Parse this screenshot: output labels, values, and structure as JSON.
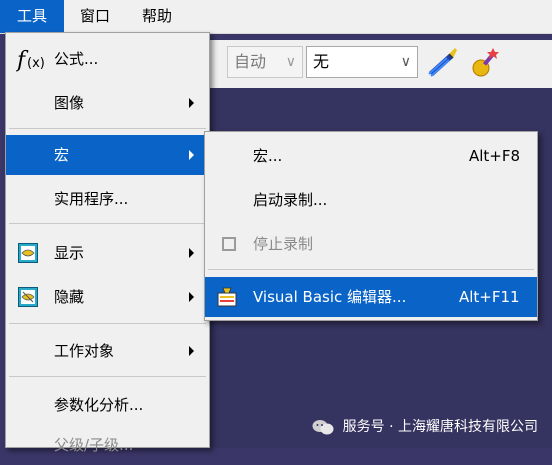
{
  "menubar": {
    "items": [
      {
        "label": "工具"
      },
      {
        "label": "窗口"
      },
      {
        "label": "帮助"
      }
    ]
  },
  "toolbar": {
    "combo_auto": {
      "value": "自动"
    },
    "combo_none": {
      "value": "无"
    },
    "dropdown_glyph": "∨"
  },
  "tools_menu": {
    "items": [
      {
        "label": "公式..."
      },
      {
        "label": "图像"
      },
      {
        "label": "宏"
      },
      {
        "label": "实用程序..."
      },
      {
        "label": "显示"
      },
      {
        "label": "隐藏"
      },
      {
        "label": "工作对象"
      },
      {
        "label": "参数化分析..."
      },
      {
        "label": "父级/子级..."
      }
    ]
  },
  "macro_submenu": {
    "items": [
      {
        "label": "宏...",
        "shortcut": "Alt+F8"
      },
      {
        "label": "启动录制..."
      },
      {
        "label": "停止录制"
      },
      {
        "label": "Visual Basic 编辑器...",
        "shortcut": "Alt+F11"
      }
    ]
  },
  "watermark": {
    "text": "服务号 · 上海耀唐科技有限公司"
  }
}
